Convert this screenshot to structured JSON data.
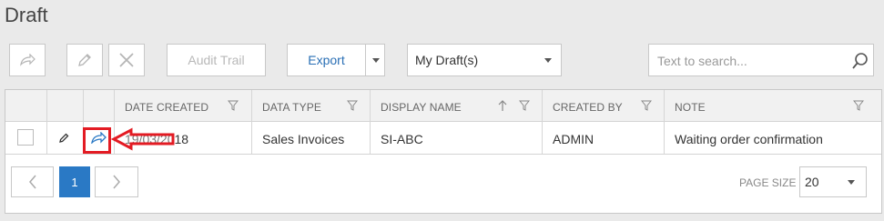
{
  "page": {
    "title": "Draft"
  },
  "toolbar": {
    "audit_trail_label": "Audit Trail",
    "export_label": "Export",
    "filter_select": "My Draft(s)",
    "search_placeholder": "Text to search..."
  },
  "grid": {
    "columns": [
      "DATE CREATED",
      "DATA TYPE",
      "DISPLAY NAME",
      "CREATED BY",
      "NOTE"
    ],
    "rows": [
      {
        "date_created": "19/03/2018",
        "data_type": "Sales Invoices",
        "display_name": "SI-ABC",
        "created_by": "ADMIN",
        "note": "Waiting order confirmation"
      }
    ]
  },
  "pagination": {
    "current_page": "1",
    "page_size_label": "PAGE SIZE",
    "page_size": "20"
  },
  "colors": {
    "accent": "#2a79c5",
    "annotation": "#e31b23"
  }
}
